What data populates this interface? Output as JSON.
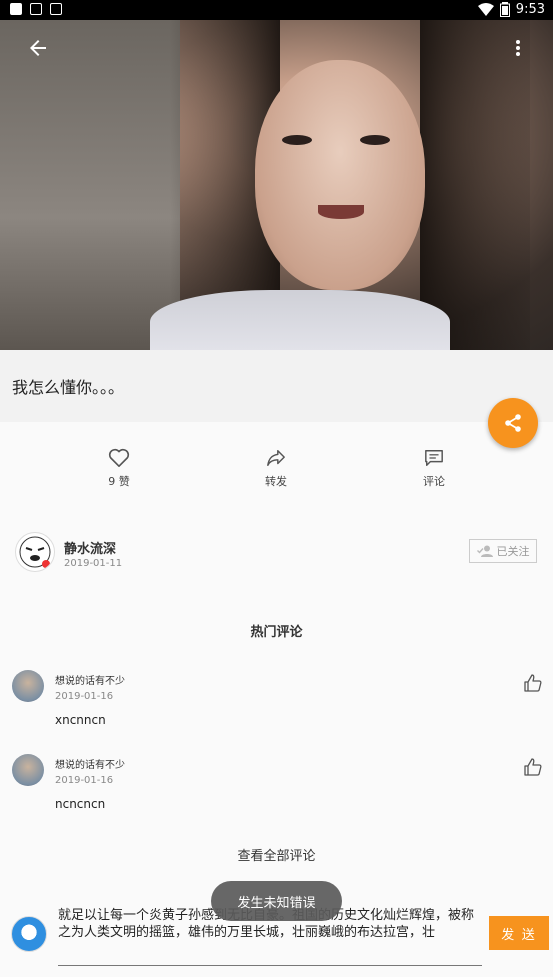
{
  "status_bar": {
    "time": "9:53",
    "battery_label": "⚡"
  },
  "post": {
    "title": "我怎么懂你。。。"
  },
  "actions": {
    "like_label": "9 赞",
    "share_label": "转发",
    "comment_label": "评论"
  },
  "author": {
    "name": "静水流深",
    "date": "2019-01-11",
    "follow_label": "已关注"
  },
  "hot_comments_title": "热门评论",
  "comments": [
    {
      "name": "想说的话有不少",
      "date": "2019-01-16",
      "text": "xncnncn"
    },
    {
      "name": "想说的话有不少",
      "date": "2019-01-16",
      "text": "ncncncn"
    }
  ],
  "view_all_label": "查看全部评论",
  "toast": "发生未知错误",
  "input": {
    "value": "就足以让每一个炎黄子孙感到无比自豪。祖国的历史文化灿烂辉煌，被称之为人类文明的摇篮，雄伟的万里长城，壮丽巍峨的布达拉宫，壮"
  },
  "send_label": "发 送",
  "colors": {
    "accent": "#f7931e"
  }
}
